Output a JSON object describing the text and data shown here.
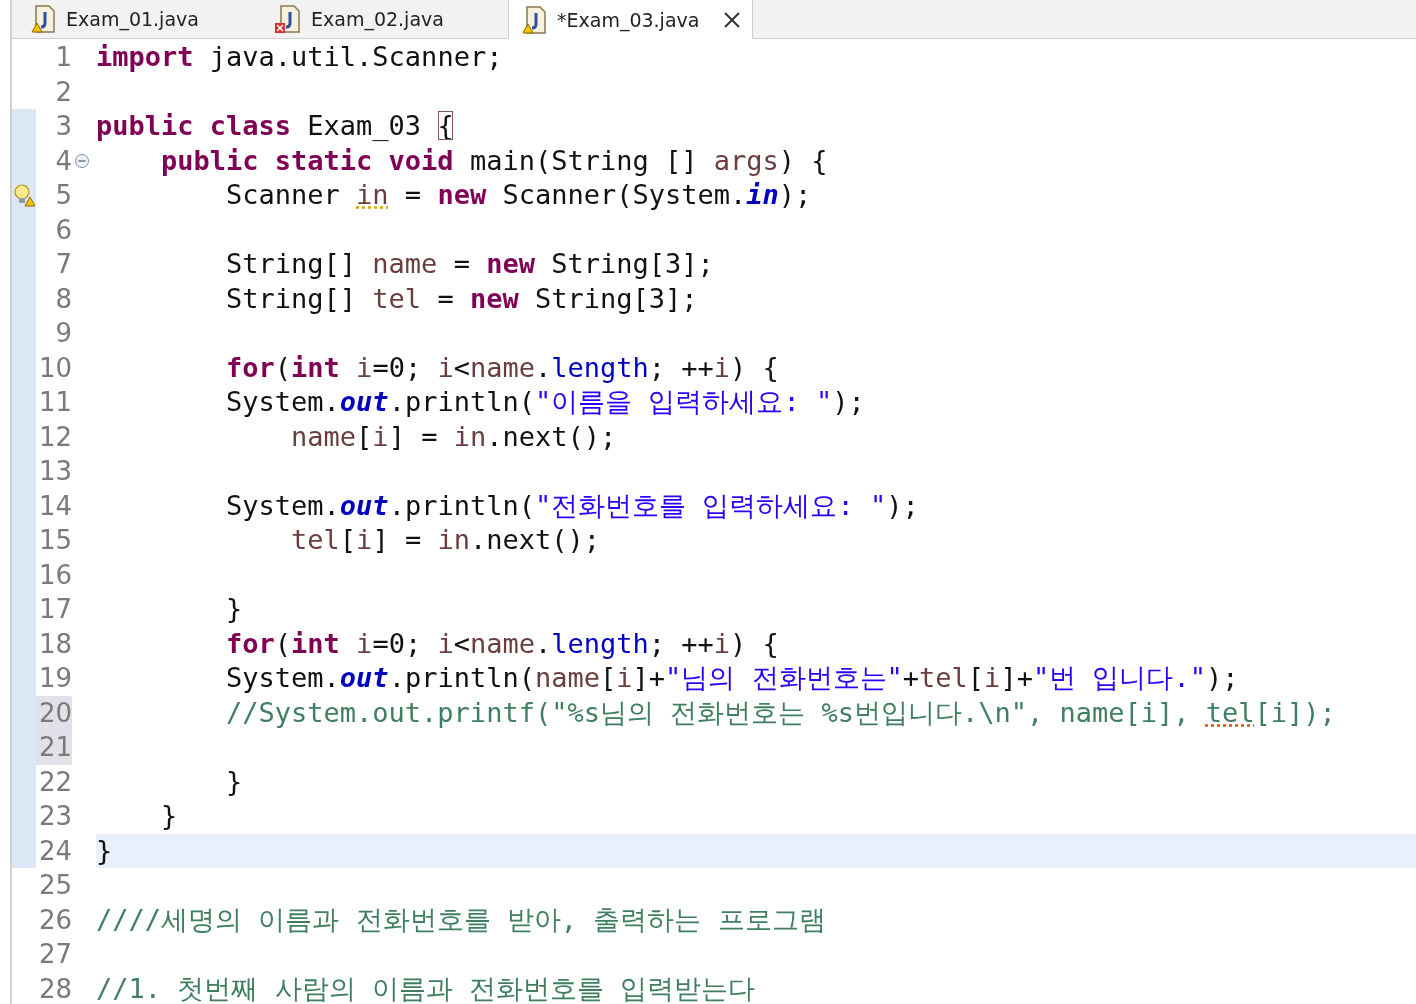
{
  "tabs": [
    {
      "label": "Exam_01.java",
      "kind": "warning",
      "selected": false
    },
    {
      "label": "Exam_02.java",
      "kind": "error",
      "selected": false
    },
    {
      "label": "*Exam_03.java",
      "kind": "warning",
      "selected": true
    }
  ],
  "lines": [
    {
      "number": "1",
      "in_range": false,
      "current": false,
      "selected": false,
      "tokens": [
        {
          "kind": "kw",
          "text": "import"
        },
        {
          "kind": "plain",
          "text": " java.util.Scanner;"
        }
      ]
    },
    {
      "number": "2",
      "in_range": false,
      "current": false,
      "selected": false
    },
    {
      "number": "3",
      "in_range": true,
      "current": false,
      "selected": false,
      "tokens": [
        {
          "kind": "kw",
          "text": "public class"
        },
        {
          "kind": "plain",
          "text": " Exam_03 "
        },
        {
          "kind": "bracket",
          "text": "{"
        }
      ]
    },
    {
      "number": "4",
      "in_range": true,
      "current": false,
      "selected": false,
      "kind": "fold",
      "tokens": [
        {
          "kind": "kw",
          "text": "    public static void"
        },
        {
          "kind": "plain",
          "text": " main(String [] "
        },
        {
          "kind": "var",
          "text": "args"
        },
        {
          "kind": "plain",
          "text": ") {"
        }
      ]
    },
    {
      "number": "5",
      "in_range": true,
      "current": false,
      "selected": false,
      "kind": "warning",
      "tokens": [
        {
          "kind": "plain",
          "text": "        Scanner "
        },
        {
          "kind": "var-warn",
          "text": "in"
        },
        {
          "kind": "plain",
          "text": " = "
        },
        {
          "kind": "kw",
          "text": "new"
        },
        {
          "kind": "plain",
          "text": " Scanner(System."
        },
        {
          "kind": "static",
          "text": "in"
        },
        {
          "kind": "plain",
          "text": ");"
        }
      ]
    },
    {
      "number": "6",
      "in_range": true,
      "current": false,
      "selected": false
    },
    {
      "number": "7",
      "in_range": true,
      "current": false,
      "selected": false,
      "tokens": [
        {
          "kind": "plain",
          "text": "        String[] "
        },
        {
          "kind": "var",
          "text": "name"
        },
        {
          "kind": "plain",
          "text": " = "
        },
        {
          "kind": "kw",
          "text": "new"
        },
        {
          "kind": "plain",
          "text": " String[3];"
        }
      ]
    },
    {
      "number": "8",
      "in_range": true,
      "current": false,
      "selected": false,
      "tokens": [
        {
          "kind": "plain",
          "text": "        String[] "
        },
        {
          "kind": "var",
          "text": "tel"
        },
        {
          "kind": "plain",
          "text": " = "
        },
        {
          "kind": "kw",
          "text": "new"
        },
        {
          "kind": "plain",
          "text": " String[3];"
        }
      ]
    },
    {
      "number": "9",
      "in_range": true,
      "current": false,
      "selected": false
    },
    {
      "number": "10",
      "in_range": true,
      "current": false,
      "selected": false,
      "tokens": [
        {
          "kind": "kw",
          "text": "        for"
        },
        {
          "kind": "plain",
          "text": "("
        },
        {
          "kind": "kw",
          "text": "int"
        },
        {
          "kind": "var",
          "text": " i"
        },
        {
          "kind": "plain",
          "text": "=0; "
        },
        {
          "kind": "var",
          "text": "i"
        },
        {
          "kind": "plain",
          "text": "<"
        },
        {
          "kind": "var",
          "text": "name"
        },
        {
          "kind": "plain",
          "text": "."
        },
        {
          "kind": "field",
          "text": "length"
        },
        {
          "kind": "plain",
          "text": "; ++"
        },
        {
          "kind": "var",
          "text": "i"
        },
        {
          "kind": "plain",
          "text": ") {"
        }
      ]
    },
    {
      "number": "11",
      "in_range": true,
      "current": false,
      "selected": false,
      "tokens": [
        {
          "kind": "plain",
          "text": "        System."
        },
        {
          "kind": "static",
          "text": "out"
        },
        {
          "kind": "plain",
          "text": ".println("
        },
        {
          "kind": "str",
          "text": "\"이름을 입력하세요: \""
        },
        {
          "kind": "plain",
          "text": ");"
        }
      ]
    },
    {
      "number": "12",
      "in_range": true,
      "current": false,
      "selected": false,
      "tokens": [
        {
          "kind": "var",
          "text": "            name"
        },
        {
          "kind": "plain",
          "text": "["
        },
        {
          "kind": "var",
          "text": "i"
        },
        {
          "kind": "plain",
          "text": "] = "
        },
        {
          "kind": "var",
          "text": "in"
        },
        {
          "kind": "plain",
          "text": ".next();"
        }
      ]
    },
    {
      "number": "13",
      "in_range": true,
      "current": false,
      "selected": false
    },
    {
      "number": "14",
      "in_range": true,
      "current": false,
      "selected": false,
      "tokens": [
        {
          "kind": "plain",
          "text": "        System."
        },
        {
          "kind": "static",
          "text": "out"
        },
        {
          "kind": "plain",
          "text": ".println("
        },
        {
          "kind": "str",
          "text": "\"전화번호를 입력하세요: \""
        },
        {
          "kind": "plain",
          "text": ");"
        }
      ]
    },
    {
      "number": "15",
      "in_range": true,
      "current": false,
      "selected": false,
      "tokens": [
        {
          "kind": "var",
          "text": "            tel"
        },
        {
          "kind": "plain",
          "text": "["
        },
        {
          "kind": "var",
          "text": "i"
        },
        {
          "kind": "plain",
          "text": "] = "
        },
        {
          "kind": "var",
          "text": "in"
        },
        {
          "kind": "plain",
          "text": ".next();"
        }
      ]
    },
    {
      "number": "16",
      "in_range": true,
      "current": false,
      "selected": false
    },
    {
      "number": "17",
      "in_range": true,
      "current": false,
      "selected": false,
      "tokens": [
        {
          "kind": "plain",
          "text": "        }"
        }
      ]
    },
    {
      "number": "18",
      "in_range": true,
      "current": false,
      "selected": false,
      "tokens": [
        {
          "kind": "kw",
          "text": "        for"
        },
        {
          "kind": "plain",
          "text": "("
        },
        {
          "kind": "kw",
          "text": "int"
        },
        {
          "kind": "var",
          "text": " i"
        },
        {
          "kind": "plain",
          "text": "=0; "
        },
        {
          "kind": "var",
          "text": "i"
        },
        {
          "kind": "plain",
          "text": "<"
        },
        {
          "kind": "var",
          "text": "name"
        },
        {
          "kind": "plain",
          "text": "."
        },
        {
          "kind": "field",
          "text": "length"
        },
        {
          "kind": "plain",
          "text": "; ++"
        },
        {
          "kind": "var",
          "text": "i"
        },
        {
          "kind": "plain",
          "text": ") {"
        }
      ]
    },
    {
      "number": "19",
      "in_range": true,
      "current": false,
      "selected": false,
      "tokens": [
        {
          "kind": "plain",
          "text": "        System."
        },
        {
          "kind": "static",
          "text": "out"
        },
        {
          "kind": "plain",
          "text": ".println("
        },
        {
          "kind": "var",
          "text": "name"
        },
        {
          "kind": "plain",
          "text": "["
        },
        {
          "kind": "var",
          "text": "i"
        },
        {
          "kind": "plain",
          "text": "]+"
        },
        {
          "kind": "str",
          "text": "\"님의 전화번호는\""
        },
        {
          "kind": "plain",
          "text": "+"
        },
        {
          "kind": "var",
          "text": "tel"
        },
        {
          "kind": "plain",
          "text": "["
        },
        {
          "kind": "var",
          "text": "i"
        },
        {
          "kind": "plain",
          "text": "]+"
        },
        {
          "kind": "str",
          "text": "\"번 입니다.\""
        },
        {
          "kind": "plain",
          "text": ");"
        }
      ]
    },
    {
      "number": "20",
      "in_range": true,
      "current": false,
      "selected": true,
      "tokens": [
        {
          "kind": "comment",
          "text": "        //System.out.printf(\"%s님의 전화번호는 %s번입니다.\\n\", name[i], "
        },
        {
          "kind": "comment-warn",
          "text": "tel"
        },
        {
          "kind": "comment",
          "text": "[i]);"
        }
      ]
    },
    {
      "number": "21",
      "in_range": true,
      "current": false,
      "selected": true
    },
    {
      "number": "22",
      "in_range": true,
      "current": false,
      "selected": false,
      "tokens": [
        {
          "kind": "plain",
          "text": "        }"
        }
      ]
    },
    {
      "number": "23",
      "in_range": true,
      "current": false,
      "selected": false,
      "tokens": [
        {
          "kind": "plain",
          "text": "    }"
        }
      ]
    },
    {
      "number": "24",
      "in_range": true,
      "current": true,
      "selected": false,
      "tokens": [
        {
          "kind": "plain",
          "text": "}"
        }
      ]
    },
    {
      "number": "25",
      "in_range": false,
      "current": false,
      "selected": false
    },
    {
      "number": "26",
      "in_range": false,
      "current": false,
      "selected": false,
      "tokens": [
        {
          "kind": "comment",
          "text": "////세명의 이름과 전화번호를 받아, 출력하는 프로그램"
        }
      ]
    },
    {
      "number": "27",
      "in_range": false,
      "current": false,
      "selected": false
    },
    {
      "number": "28",
      "in_range": false,
      "current": false,
      "selected": false,
      "tokens": [
        {
          "kind": "comment",
          "text": "//1. 첫번째 사람의 이름과 전화번호를 입력받는다"
        }
      ]
    }
  ]
}
